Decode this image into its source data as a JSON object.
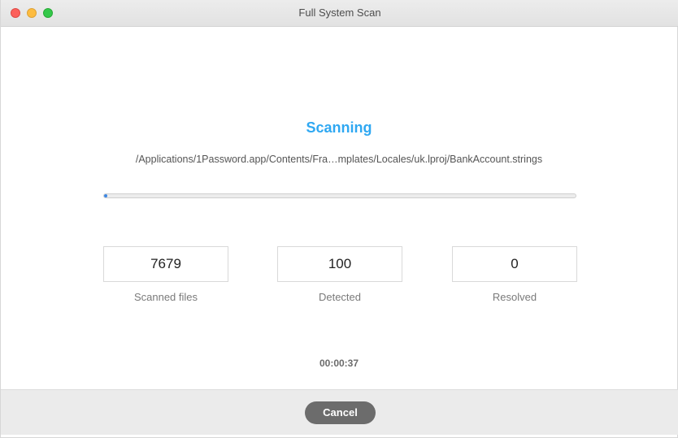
{
  "window": {
    "title": "Full System Scan"
  },
  "scan": {
    "heading": "Scanning",
    "current_path": "/Applications/1Password.app/Contents/Fra…mplates/Locales/uk.lproj/BankAccount.strings",
    "progress_fraction": 0.005,
    "elapsed": "00:00:37"
  },
  "stats": [
    {
      "value": "7679",
      "label": "Scanned files"
    },
    {
      "value": "100",
      "label": "Detected"
    },
    {
      "value": "0",
      "label": "Resolved"
    }
  ],
  "footer": {
    "cancel_label": "Cancel"
  },
  "colors": {
    "accent": "#2fa8f2",
    "progress": "#3b86e3",
    "button": "#6c6c6c",
    "traffic_close": "#fc605b",
    "traffic_minimize": "#fdbc40",
    "traffic_maximize": "#34c84a"
  }
}
